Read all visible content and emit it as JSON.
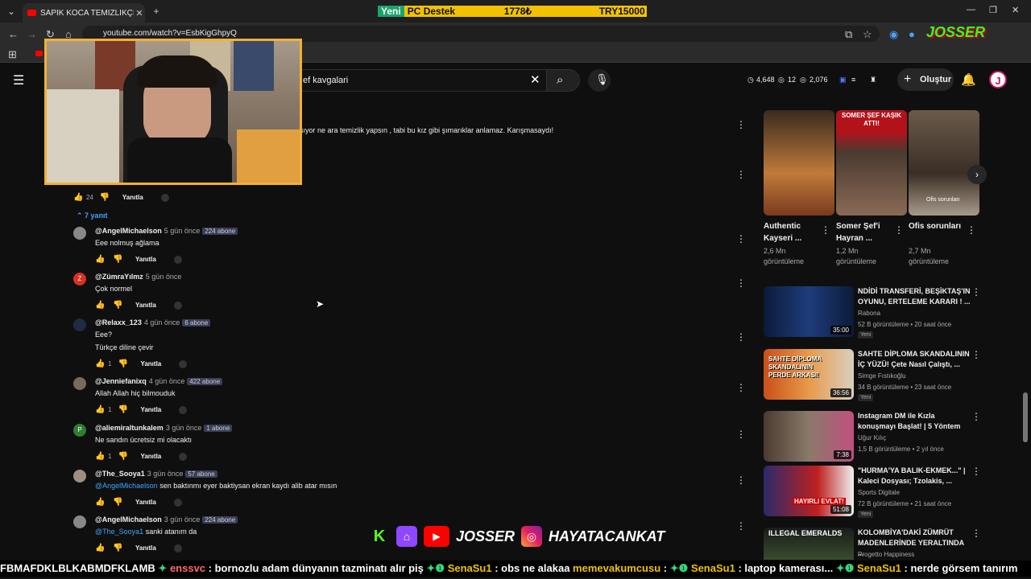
{
  "browser": {
    "tab_title": "SAPIK KOCA TEMİZLİKÇİYİ T*CİZ",
    "url": "youtube.com/watch?v=EsbKigGhpyQ"
  },
  "promo": {
    "text1": "Yeni",
    "text2": "PC Destek",
    "text3": "1778₺",
    "text4": "TRY15000"
  },
  "youtube": {
    "search_value": "ef kavgalari",
    "stats": [
      "4,648",
      "12",
      "2,076"
    ],
    "create_label": "Oluştur",
    "avatar_letter": "J"
  },
  "comments": {
    "partial_text": "şıyor ne ara temizlik yapsın , tabi bu kız gibi şımarıklar anlamaz. Karışmasaydı!",
    "top_likes": "24",
    "reply_label": "Yanıtla",
    "replies_toggle": "7 yanıt",
    "items": [
      {
        "author": "@AngelMichaelson",
        "time": "5 gün önce",
        "badge": "224 abone",
        "lines": [
          "Eee nolmuş ağlama"
        ],
        "likes": ""
      },
      {
        "author": "@ZümraYılmz",
        "time": "5 gün önce",
        "badge": "",
        "lines": [
          "Çok normel"
        ],
        "likes": ""
      },
      {
        "author": "@Relaxx_123",
        "time": "4 gün önce",
        "badge": "6 abone",
        "lines": [
          "Eee?",
          "Türkçe diline çevir"
        ],
        "likes": "1"
      },
      {
        "author": "@Jenniefanixq",
        "time": "4 gün önce",
        "badge": "422 abone",
        "lines": [
          "Allah Allah hiç bilmouduk"
        ],
        "likes": "1"
      },
      {
        "author": "@aliemiraltunkalem",
        "time": "3 gün önce",
        "badge": "1 abone",
        "lines": [
          "Ne sandın ücretsiz mi olacaktı"
        ],
        "likes": "1"
      },
      {
        "author": "@The_Sooya1",
        "time": "3 gün önce",
        "badge": "57 abone",
        "mention": "@AngelMichaelson",
        "lines": [
          " sen baktınmı eyer baktiysan ekran kaydı alib atar mısın"
        ],
        "likes": ""
      },
      {
        "author": "@AngelMichaelson",
        "time": "3 gün önce",
        "badge": "224 abone",
        "mention": "@The_Sooya1",
        "lines": [
          " sanki atanım da"
        ],
        "likes": ""
      }
    ]
  },
  "shorts": [
    {
      "title": "Authentic Kayseri ...",
      "views": "2,6 Mn görüntüleme",
      "overlay": ""
    },
    {
      "title": "Somer Şef'i Hayran ...",
      "views": "1,2 Mn görüntüleme",
      "overlay": "SOMER ŞEF KAŞIK ATTI!"
    },
    {
      "title": "Ofis sorunları",
      "views": "2,7 Mn görüntüleme",
      "overlay": "Ofis sorunları"
    }
  ],
  "related": [
    {
      "title": "NDİDİ TRANSFERİ, BEŞİKTAŞ'IN OYUNU, ERTELEME KARARI ! ...",
      "channel": "Rabona",
      "meta": "52 B görüntüleme • 20 saat önce",
      "new": "Yeni",
      "duration": "35:00"
    },
    {
      "title": "SAHTE DİPLOMA SKANDALININ İÇ YÜZÜ! Çete Nasıl Çalıştı, ...",
      "channel": "Simge Fıstıkoğlu",
      "meta": "34 B görüntüleme • 23 saat önce",
      "new": "Yeni",
      "duration": "36:56",
      "overlay": "SAHTE DİPLOMA SKANDALININ PERDE ARKASI!"
    },
    {
      "title": "Instagram DM ile Kızla konuşmayı Başlat! | 5 Yöntem",
      "channel": "Uğur Kılıç",
      "meta": "1,5 B görüntüleme • 2 yıl önce",
      "new": "",
      "duration": "7:38"
    },
    {
      "title": "\"HURMA'YA BALIK-EKMEK...\" | Kaleci Dosyası; Tzolakis, ...",
      "channel": "Sports Digitale",
      "meta": "72 B görüntüleme • 21 saat önce",
      "new": "Yeni",
      "duration": "51:08",
      "overlay": "HAYIRLI EVLAT!"
    },
    {
      "title": "KOLOMBİYA'DAKİ ZÜMRÜT MADENLERİNDE YERALTINDA ...",
      "channel": "Progetto Happiness",
      "meta": "",
      "new": "",
      "duration": "",
      "overlay": "ILLEGAL EMERALDS"
    }
  ],
  "social": {
    "josser": "JOSSER",
    "instagram": "HAYATACANKAT"
  },
  "ticker": {
    "p0": "FBMAFDKLBLKABMDFKLAMB",
    "u1": "enssvc",
    "m1": " : bornozlu adam dünyanın tazminatı alır piş ",
    "u2": "SenaSu1",
    "m2": " : obs ne alakaa ",
    "u3": "memevakumcusu",
    "m3": " : ",
    "u4": "SenaSu1",
    "m4": " : laptop kamerası... ",
    "u5": "SenaSu1",
    "m5": " : nerde görsem tanırım"
  },
  "colors": {
    "accent_red": "#ff0000",
    "link_blue": "#3ea6ff",
    "webcam_border": "#f2b035",
    "promo_yellow": "#f2c200"
  }
}
